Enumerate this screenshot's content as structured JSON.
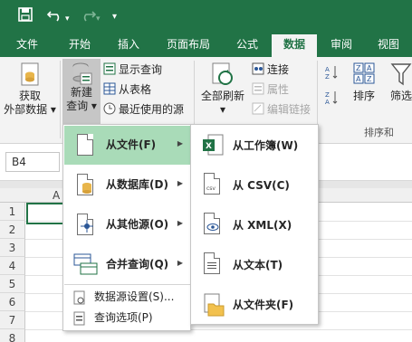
{
  "quick_access": {
    "save_icon": "save-icon",
    "undo_icon": "undo-icon",
    "redo_icon": "redo-icon",
    "customize_icon": "customize-qat-icon"
  },
  "tabs": [
    {
      "label": "文件",
      "active": false
    },
    {
      "label": "开始",
      "active": false
    },
    {
      "label": "插入",
      "active": false
    },
    {
      "label": "页面布局",
      "active": false
    },
    {
      "label": "公式",
      "active": false
    },
    {
      "label": "数据",
      "active": true
    },
    {
      "label": "审阅",
      "active": false
    },
    {
      "label": "视图",
      "active": false
    }
  ],
  "ribbon": {
    "get_external_data": {
      "line1": "获取",
      "line2": "外部数据 ▾"
    },
    "new_query": {
      "line1": "新建",
      "line2": "查询 ▾"
    },
    "show_queries": "显示查询",
    "from_table": "从表格",
    "recent_sources": "最近使用的源",
    "refresh_all": {
      "line1": "全部刷新",
      "line2": "▾"
    },
    "connections": "连接",
    "properties": "属性",
    "edit_links": "编辑链接",
    "sort": "排序",
    "filter": "筛选",
    "sort_filter_group": "排序和"
  },
  "formula_bar": {
    "name_box": "B4"
  },
  "grid": {
    "column_headers": [
      "A"
    ],
    "row_headers": [
      "1",
      "2",
      "3",
      "4",
      "5",
      "6",
      "7",
      "8"
    ]
  },
  "new_query_menu": {
    "items": [
      {
        "label": "从文件(F)",
        "icon": "file-icon",
        "highlighted": true
      },
      {
        "label": "从数据库(D)",
        "icon": "database-icon",
        "highlighted": false
      },
      {
        "label": "从其他源(O)",
        "icon": "other-sources-icon",
        "highlighted": false
      },
      {
        "label": "合并查询(Q)",
        "icon": "combine-queries-icon",
        "highlighted": false
      }
    ],
    "small_items": [
      {
        "label": "数据源设置(S)...",
        "icon": "data-source-settings-icon"
      },
      {
        "label": "查询选项(P)",
        "icon": "query-options-icon"
      }
    ]
  },
  "from_file_submenu": {
    "items": [
      {
        "label": "从工作簿(W)",
        "icon": "excel-workbook-icon"
      },
      {
        "label": "从 CSV(C)",
        "icon": "csv-file-icon"
      },
      {
        "label": "从 XML(X)",
        "icon": "xml-file-icon"
      },
      {
        "label": "从文本(T)",
        "icon": "text-file-icon"
      },
      {
        "label": "从文件夹(F)",
        "icon": "folder-icon"
      }
    ]
  },
  "colors": {
    "accent": "#217346",
    "highlight": "#a9dbb8"
  }
}
